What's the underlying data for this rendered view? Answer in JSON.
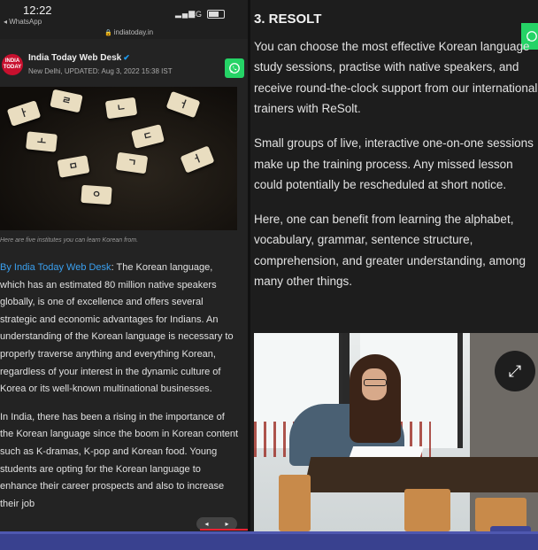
{
  "status_bar": {
    "time": "12:22",
    "back_app": "◂ WhatsApp",
    "network": "4G",
    "url": "indiatoday.in"
  },
  "author": {
    "logo_text": "INDIA TODAY",
    "name": "India Today Web Desk",
    "meta": "New Delhi, UPDATED: Aug 3, 2022 15:38 IST"
  },
  "photo": {
    "tiles": [
      "ㅏ",
      "ㄹ",
      "ㄴ",
      "ㅓ",
      "ㅗ",
      "ㄷ",
      "ㅁ",
      "ㄱ",
      "ㅓ",
      "ㅇ"
    ]
  },
  "caption": "Here are five institutes you can learn Korean from.",
  "article": {
    "byline": "By India Today Web Desk",
    "para1": ": The Korean language, which has an estimated 80 million native speakers globally, is one of excellence and offers several strategic and economic advantages for Indians. An understanding of the Korean language is necessary to properly traverse anything and everything Korean, regardless of your interest in the dynamic culture of Korea or its well-known multinational businesses.",
    "para2": "In India, there has been a rising in the importance of the Korean language since the boom in Korean content such as K-dramas, K-pop and Korean food. Young students are opting for the Korean language to enhance their career prospects and also to increase their job"
  },
  "slide_control": {
    "prev": "◂",
    "next": "▸"
  },
  "right": {
    "heading": "3. RESOLT",
    "p1": "You can choose the most effective Korean language study sessions, practise with native speakers, and receive round-the-clock support from our international trainers with ReSolt.",
    "p2": "Small groups of live, interactive one-on-one sessions make up the training process. Any missed lesson could potentially be rescheduled at short notice.",
    "p3": "Here, one can benefit from learning the alphabet, vocabulary, grammar, sentence structure, comprehension, and greater understanding, among many other things."
  },
  "colors": {
    "byline": "#3aa0f0",
    "whatsapp": "#25d366",
    "bottom_bar": "#39418f",
    "logo": "#c8102e"
  },
  "icons": [
    "whatsapp-icon",
    "expand-icon",
    "verified-icon",
    "lock-icon",
    "battery-icon",
    "signal-icon"
  ]
}
